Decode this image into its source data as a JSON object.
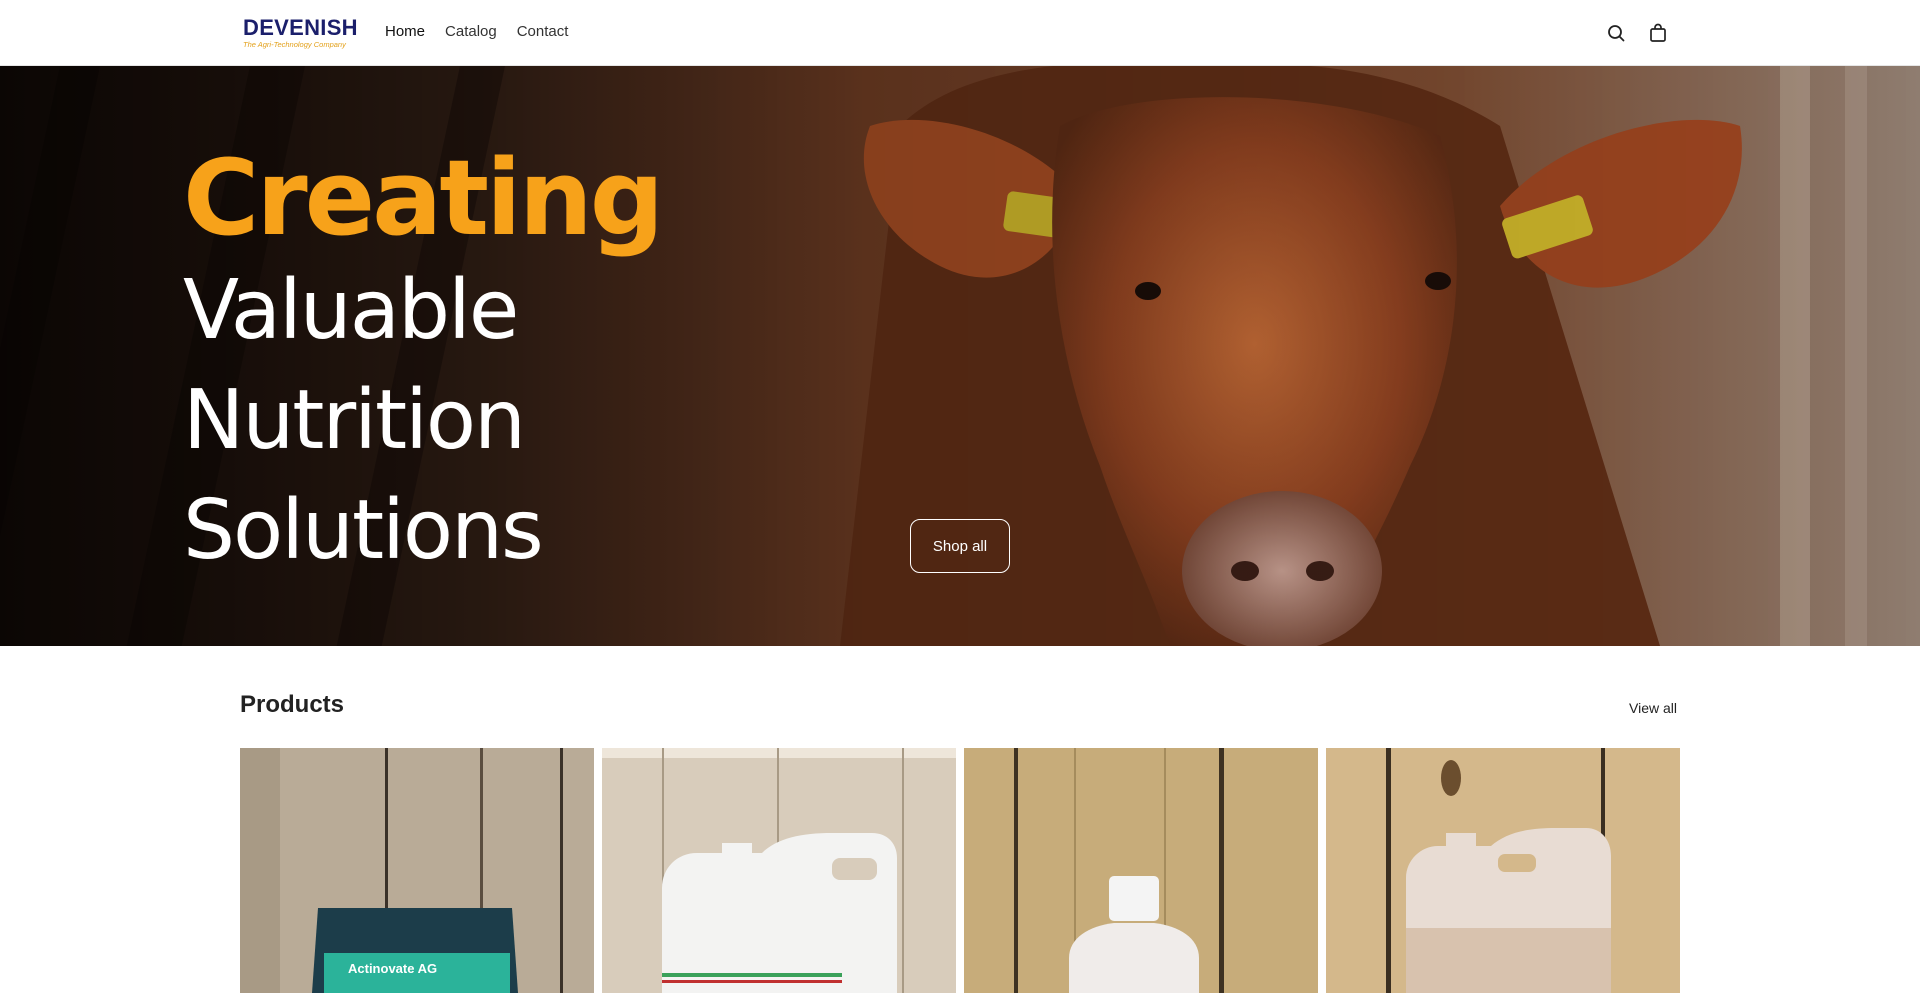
{
  "header": {
    "logo_text": "DEVENISH",
    "logo_tagline": "The Agri-Technology Company",
    "nav": [
      {
        "label": "Home"
      },
      {
        "label": "Catalog"
      },
      {
        "label": "Contact"
      }
    ],
    "icons": [
      "search-icon",
      "cart-icon"
    ]
  },
  "hero": {
    "line1": "Creating",
    "line2": "Valuable",
    "line3": "Nutrition",
    "line4": "Solutions",
    "button_label": "Shop all",
    "accent_color": "#f7a21a"
  },
  "products": {
    "title": "Products",
    "view_all": "View all",
    "items": [
      {
        "label": "Actinovate AG"
      },
      {
        "label": ""
      },
      {
        "label": ""
      },
      {
        "label": ""
      }
    ]
  }
}
